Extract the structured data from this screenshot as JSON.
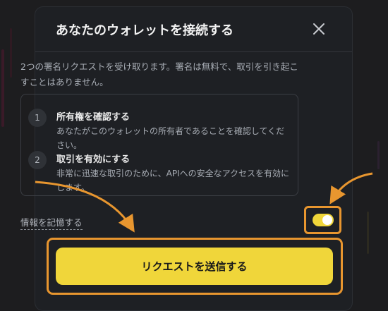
{
  "modal": {
    "title": "あなたのウォレットを接続する",
    "description": "2つの署名リクエストを受け取ります。署名は無料で、取引を引き起こすことはありません。",
    "steps": [
      {
        "number": "1",
        "title": "所有権を確認する",
        "description": "あなたがこのウォレットの所有者であることを確認してください。"
      },
      {
        "number": "2",
        "title": "取引を有効にする",
        "description": "非常に迅速な取引のために、APIへの安全なアクセスを有効にします。"
      }
    ],
    "remember_label": "情報を記憶する",
    "remember_enabled": true,
    "submit_label": "リクエストを送信する"
  },
  "colors": {
    "accent_yellow": "#f0d63a",
    "highlight_orange": "#e8962f",
    "modal_bg": "#1e2024"
  },
  "icons": {
    "close": "close-icon"
  }
}
